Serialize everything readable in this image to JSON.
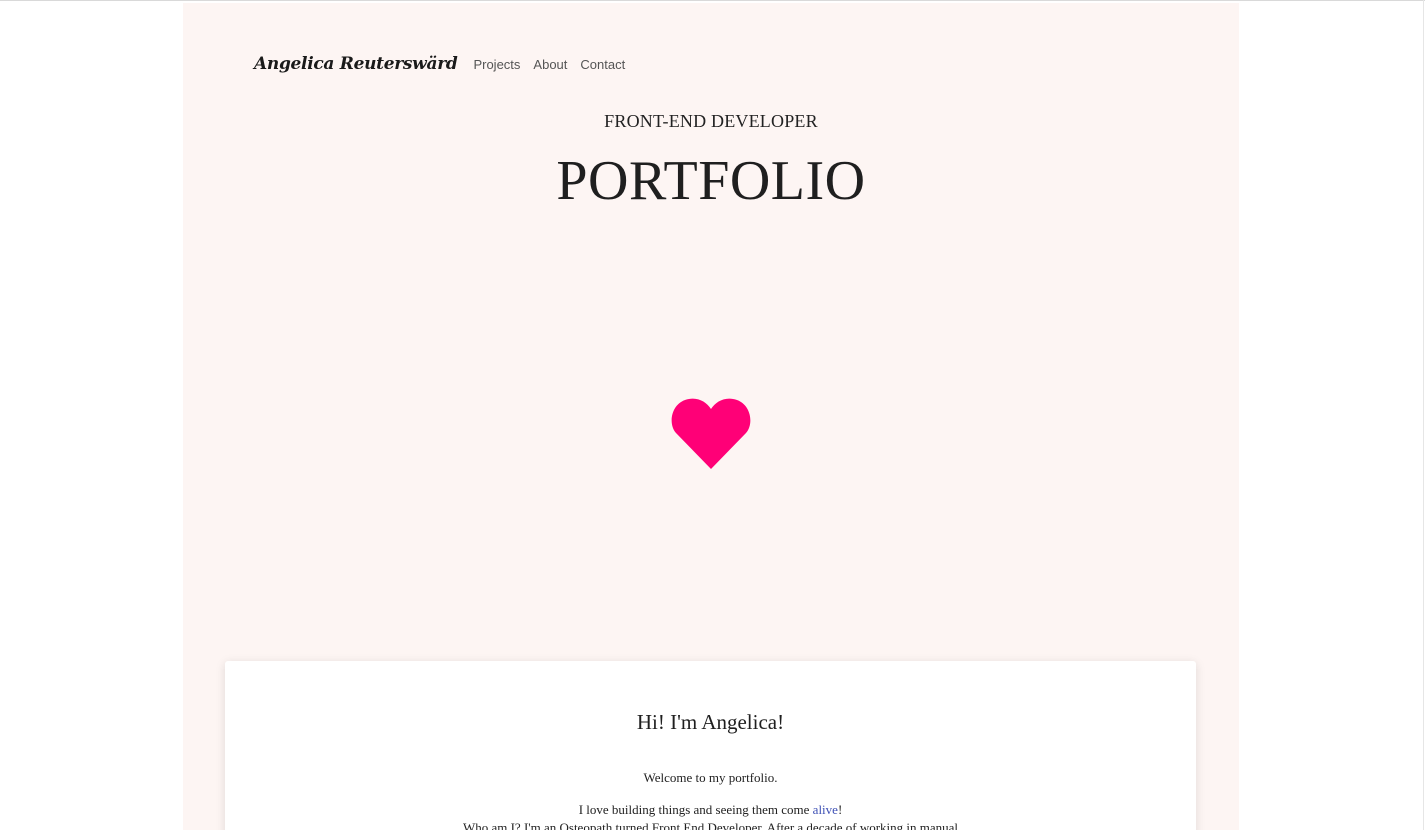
{
  "header": {
    "brand": "Angelica Reuterswärd",
    "nav": [
      {
        "label": "Projects"
      },
      {
        "label": "About"
      },
      {
        "label": "Contact"
      }
    ]
  },
  "hero": {
    "subtitle": "FRONT-END DEVELOPER",
    "title": "PORTFOLIO",
    "heart_icon": "heart-icon",
    "heart_color": "#ff0077"
  },
  "intro": {
    "heading": "Hi! I'm Angelica!",
    "welcome": "Welcome to my portfolio.",
    "love_prefix": "I love building things and seeing them come ",
    "love_link": "alive",
    "love_suffix": "!",
    "who": "Who am I? I'm an Osteopath turned Front End Developer. After a decade of working in manual"
  },
  "colors": {
    "page_background": "#fdf5f3",
    "link": "#3f51b5"
  }
}
